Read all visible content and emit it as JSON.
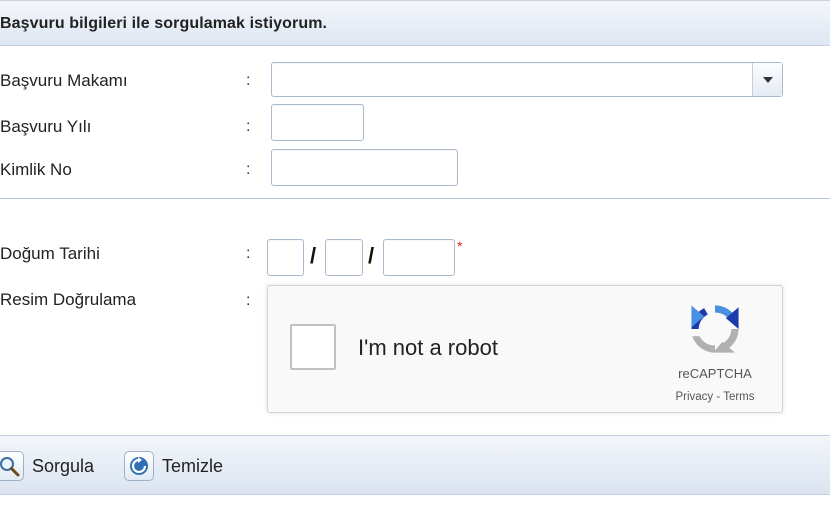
{
  "header": {
    "title": "Başvuru bilgileri ile sorgulamak istiyorum."
  },
  "form": {
    "colon": ":",
    "basvuru_makami": {
      "label": "Başvuru Makamı",
      "value": ""
    },
    "basvuru_yili": {
      "label": "Başvuru Yılı",
      "value": ""
    },
    "kimlik_no": {
      "label": "Kimlik No",
      "value": ""
    },
    "dogum_tarihi": {
      "label": "Doğum Tarihi",
      "day": "",
      "month": "",
      "year": "",
      "separator": "/",
      "required_marker": "*"
    },
    "resim_dogrulama": {
      "label": "Resim Doğrulama"
    }
  },
  "captcha": {
    "checkbox_label": "I'm not a robot",
    "brand": "reCAPTCHA",
    "privacy": "Privacy",
    "link_separator": " - ",
    "terms": "Terms",
    "logo_colors": {
      "blue": "#1c3aa9",
      "light_blue": "#4a90e2",
      "gray": "#b1b1b1"
    }
  },
  "footer": {
    "sorgula_label": "Sorgula",
    "temizle_label": "Temizle"
  }
}
